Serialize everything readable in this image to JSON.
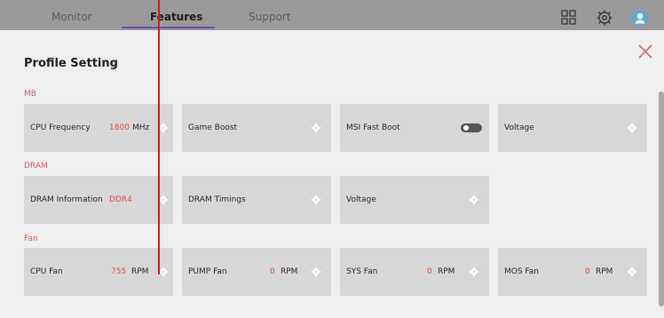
{
  "top": {
    "tabs": [
      {
        "label": "Monitor"
      },
      {
        "label": "Features"
      },
      {
        "label": "Support"
      }
    ]
  },
  "page": {
    "title": "Profile Setting"
  },
  "sections": [
    {
      "label": "MB",
      "cards": [
        {
          "label": "CPU Frequency",
          "value": "1800",
          "unit": "MHz"
        },
        {
          "label": "Game Boost"
        },
        {
          "label": "MSI Fast Boot",
          "toggle": "on"
        },
        {
          "label": "Voltage"
        }
      ]
    },
    {
      "label": "DRAM",
      "cards": [
        {
          "label": "DRAM Information",
          "value": "DDR4"
        },
        {
          "label": "DRAM Timings"
        },
        {
          "label": "Voltage"
        }
      ]
    },
    {
      "label": "Fan",
      "cards": [
        {
          "label": "CPU Fan",
          "value": "755",
          "unit": "RPM"
        },
        {
          "label": "PUMP Fan",
          "value": "0",
          "unit": "RPM"
        },
        {
          "label": "SYS Fan",
          "value": "0",
          "unit": "RPM"
        },
        {
          "label": "MOS Fan",
          "value": "0",
          "unit": "RPM"
        }
      ]
    }
  ],
  "colors": {
    "accent": "#dc5a5a",
    "pointer": "#c91f2c",
    "tab_underline": "#6b4fb8",
    "card_bg": "#d7d7d7"
  },
  "icons": {
    "layout_icon": "grid-icon",
    "settings_icon": "gear-icon",
    "profile_icon": "avatar-icon",
    "close_icon": "close-icon"
  }
}
